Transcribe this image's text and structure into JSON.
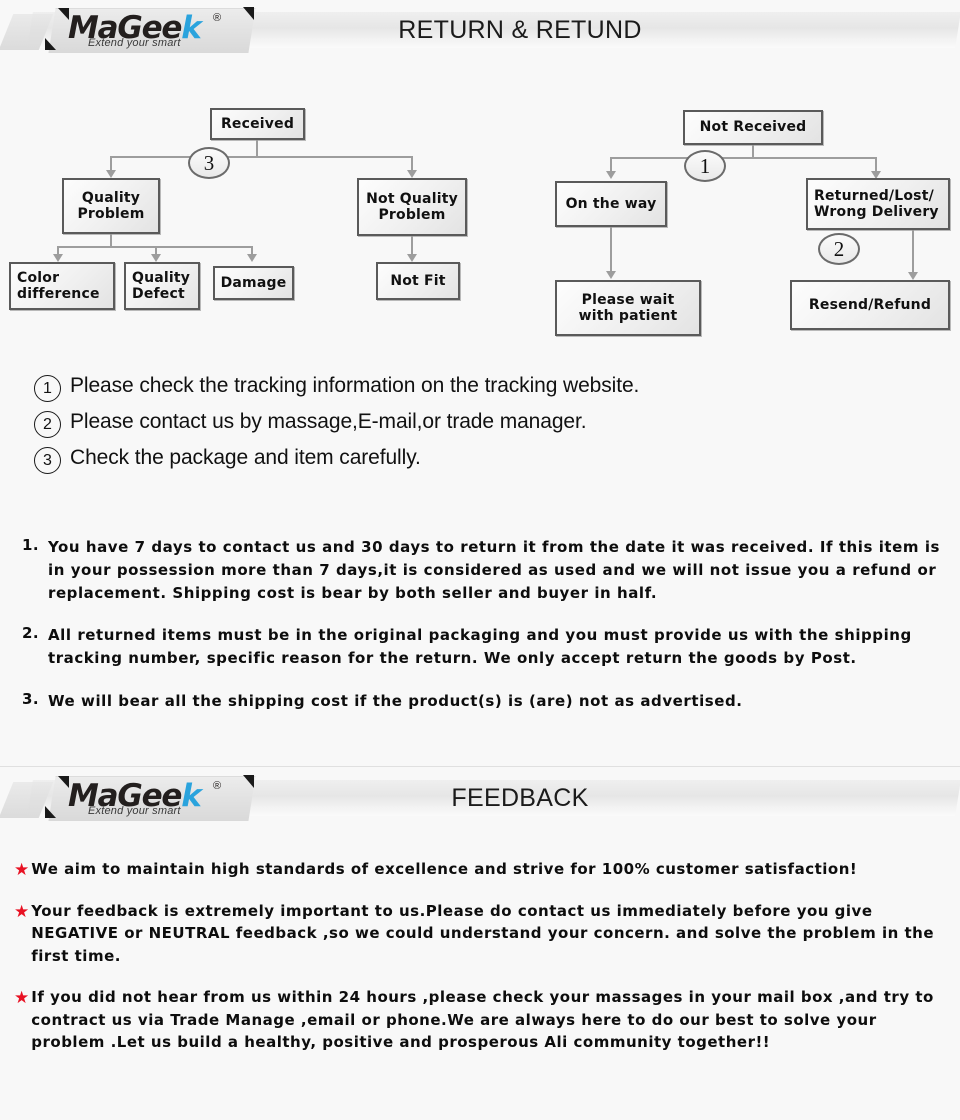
{
  "brand": {
    "name_part1": "MaGee",
    "name_k": "k",
    "registered": "®",
    "tagline": "Extend your smart"
  },
  "headers": {
    "return": "RETURN & RETUND",
    "feedback": "FEEDBACK"
  },
  "flow": {
    "received": "Received",
    "not_received": "Not  Received",
    "quality_problem": "Quality\nProblem",
    "not_quality_problem": "Not Quality\nProblem",
    "color_difference": "Color\ndifference",
    "quality_defect": "Quality\nDefect",
    "damage": "Damage",
    "not_fit": "Not Fit",
    "on_the_way": "On the way",
    "returned_lost": "Returned/Lost/\nWrong Delivery",
    "please_wait": "Please wait\nwith patient",
    "resend_refund": "Resend/Refund",
    "marker_1": "1",
    "marker_2": "2",
    "marker_3": "3"
  },
  "steps": [
    {
      "num": "1",
      "text": "Please check the tracking information on the tracking website."
    },
    {
      "num": "2",
      "text": "Please contact us by  massage,E-mail,or trade manager."
    },
    {
      "num": "3",
      "text": "Check the package and item carefully."
    }
  ],
  "policies": [
    {
      "num": "1.",
      "text": "You have 7 days to contact us and 30 days to return it from the date it was received. If this item is in your possession more than 7 days,it is considered as used and we will not issue you a refund or replacement. Shipping cost is bear by both seller and buyer in half."
    },
    {
      "num": "2.",
      "text": "All returned items must be in the original packaging and you must provide us with the shipping tracking number, specific reason for the return. We only accept return the goods by Post."
    },
    {
      "num": "3.",
      "text": "We will bear all the shipping cost if the product(s) is (are) not as advertised."
    }
  ],
  "feedback_items": [
    {
      "marker": "★",
      "text": "We aim to maintain high standards of excellence and strive  for 100% customer satisfaction!"
    },
    {
      "marker": "★",
      "text": "Your feedback is extremely important to us.Please do contact us immediately before you give NEGATIVE or NEUTRAL feedback ,so  we could understand your concern. and solve the problem in the first time."
    },
    {
      "marker": "★",
      "text": "If you did not hear from us within 24 hours ,please check your massages in your mail box ,and try to contract us via Trade Manage ,email or phone.We are always here to do our best to solve your problem .Let us build a healthy, positive and prosperous Ali community together!!"
    }
  ],
  "colors": {
    "background": "#f8f8f8",
    "star_red": "#e81123",
    "logo_blue": "#2aa3dd",
    "node_border": "#5a5a5a",
    "connector": "#9d9d9d"
  }
}
